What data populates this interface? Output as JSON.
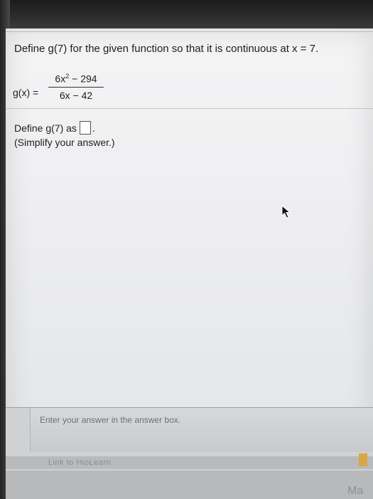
{
  "question": {
    "text": "Define g(7) for the given function so that it is continuous at x = 7."
  },
  "function": {
    "lhs": "g(x) =",
    "numerator": "6x",
    "numerator_exp": "2",
    "numerator_rest": " − 294",
    "denominator": "6x − 42"
  },
  "answer": {
    "prefix": "Define g(7) as",
    "suffix": ".",
    "hint": "(Simplify your answer.)",
    "value": ""
  },
  "status": {
    "message": "Enter your answer in the answer box."
  },
  "footer": {
    "link_label": "Link to HioLearn",
    "corner_text": "Ma"
  },
  "colors": {
    "text": "#1e1e1e",
    "accent_corner": "#d8a844"
  }
}
